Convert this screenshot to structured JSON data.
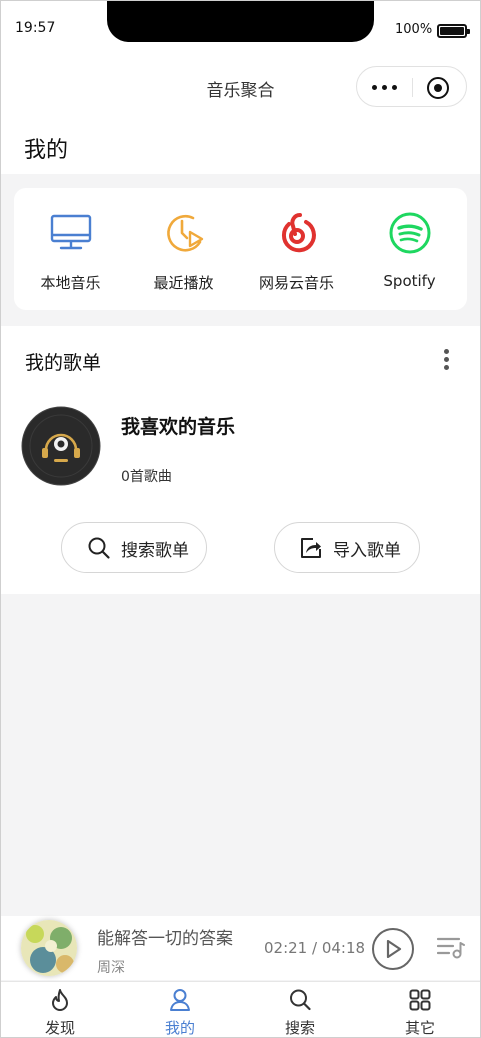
{
  "status_bar": {
    "time": "19:57",
    "battery_text": "100%"
  },
  "nav": {
    "title": "音乐聚合"
  },
  "page": {
    "title": "我的"
  },
  "sources": [
    {
      "label": "本地音乐",
      "icon": "monitor-icon"
    },
    {
      "label": "最近播放",
      "icon": "recent-play-icon"
    },
    {
      "label": "网易云音乐",
      "icon": "netease-icon"
    },
    {
      "label": "Spotify",
      "icon": "spotify-icon"
    }
  ],
  "playlists": {
    "title": "我的歌单",
    "items": [
      {
        "name": "我喜欢的音乐",
        "count": "0首歌曲"
      }
    ],
    "search_label": "搜索歌单",
    "import_label": "导入歌单"
  },
  "player": {
    "title": "能解答一切的答案",
    "artist": "周深",
    "time": "02:21 / 04:18"
  },
  "tabs": [
    {
      "label": "发现",
      "icon": "flame-icon"
    },
    {
      "label": "我的",
      "icon": "user-icon",
      "active": true
    },
    {
      "label": "搜索",
      "icon": "search-icon"
    },
    {
      "label": "其它",
      "icon": "grid-icon"
    }
  ],
  "colors": {
    "accent": "#4a7fd1",
    "local_music": "#4a7fd1",
    "recent_play": "#f0a93b",
    "netease": "#e0322f",
    "spotify": "#1ed760"
  }
}
